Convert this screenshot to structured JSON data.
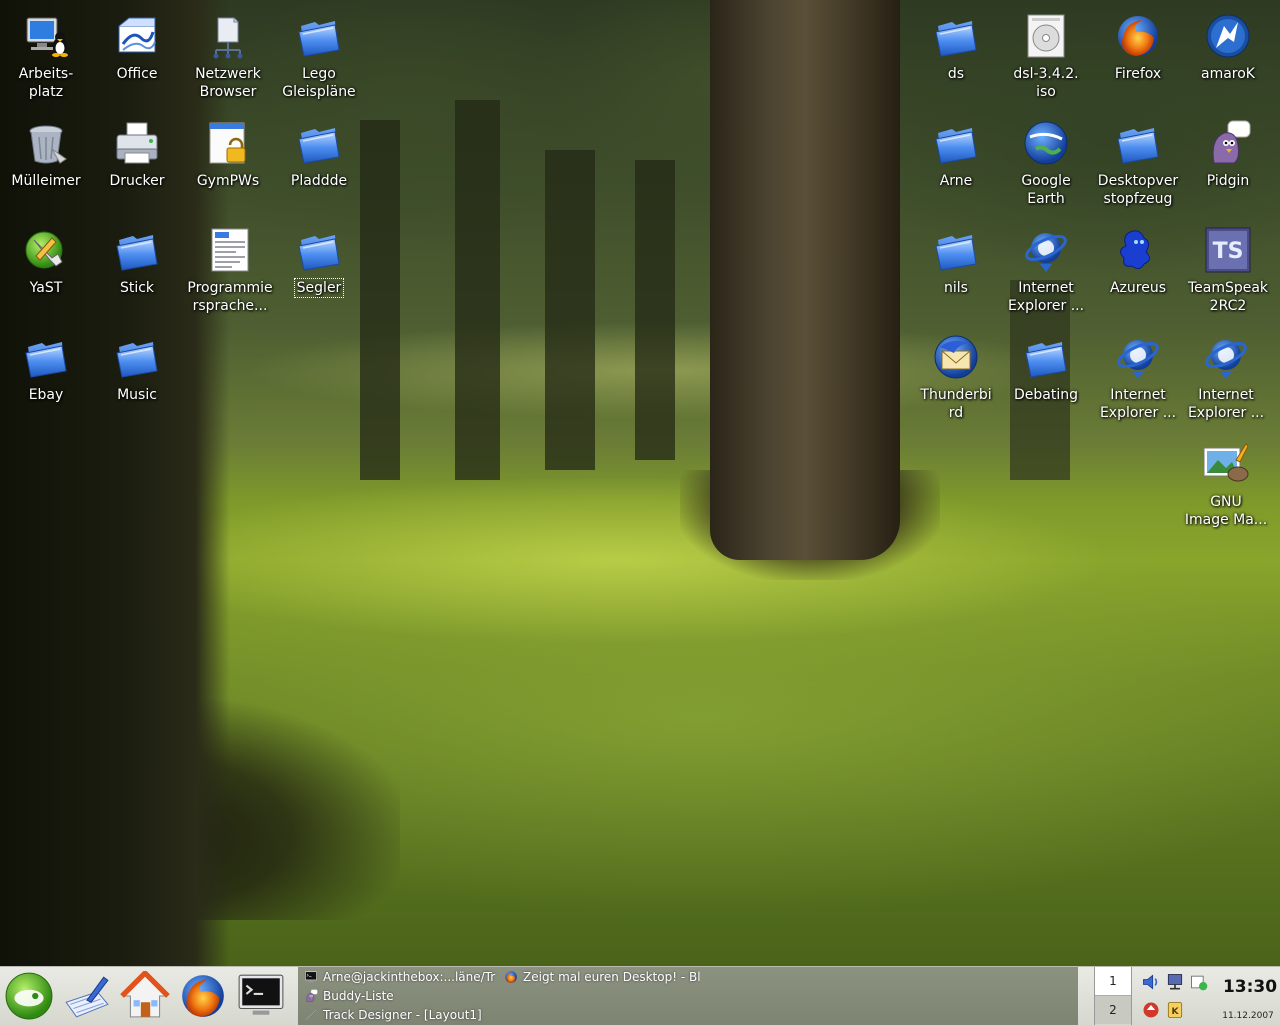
{
  "desktop": {
    "icons_left": [
      {
        "label": "Arbeits-\nplatz",
        "icon": "computer-icon"
      },
      {
        "label": "Office",
        "icon": "office-icon"
      },
      {
        "label": "Netzwerk\nBrowser",
        "icon": "network-icon"
      },
      {
        "label": "Lego\nGleispläne",
        "icon": "folder-icon"
      },
      {
        "label": "Mülleimer",
        "icon": "trash-icon"
      },
      {
        "label": "Drucker",
        "icon": "printer-icon"
      },
      {
        "label": "GymPWs",
        "icon": "locked-file-icon"
      },
      {
        "label": "Pladdde",
        "icon": "folder-icon"
      },
      {
        "label": "YaST",
        "icon": "yast-icon"
      },
      {
        "label": "Stick",
        "icon": "folder-icon"
      },
      {
        "label": "Programmie\nrsprache...",
        "icon": "document-icon"
      },
      {
        "label": "Segler",
        "icon": "folder-icon"
      },
      {
        "label": "Ebay",
        "icon": "folder-icon"
      },
      {
        "label": "Music",
        "icon": "folder-icon"
      }
    ],
    "icons_right": [
      {
        "label": "ds",
        "icon": "folder-icon"
      },
      {
        "label": "dsl-3.4.2.\niso",
        "icon": "disc-image-icon"
      },
      {
        "label": "Firefox",
        "icon": "firefox-icon"
      },
      {
        "label": "amaroK",
        "icon": "amarok-icon"
      },
      {
        "label": "Arne",
        "icon": "folder-icon"
      },
      {
        "label": "Google\nEarth",
        "icon": "google-earth-icon"
      },
      {
        "label": "Desktopver\nstopfzeug",
        "icon": "folder-icon"
      },
      {
        "label": "Pidgin",
        "icon": "pidgin-icon"
      },
      {
        "label": "nils",
        "icon": "folder-icon"
      },
      {
        "label": "Internet\nExplorer ...",
        "icon": "internet-explorer-icon"
      },
      {
        "label": "Azureus",
        "icon": "azureus-icon"
      },
      {
        "label": "TeamSpeak\n2RC2",
        "icon": "teamspeak-icon"
      },
      {
        "label": "Thunderbi\nrd",
        "icon": "thunderbird-icon"
      },
      {
        "label": "Debating",
        "icon": "folder-icon"
      },
      {
        "label": "Internet\nExplorer ...",
        "icon": "internet-explorer-icon"
      },
      {
        "label": "Internet\nExplorer ...",
        "icon": "internet-explorer-icon"
      },
      {
        "label": "GNU\nImage Ma...",
        "icon": "gimp-icon"
      }
    ]
  },
  "taskbar": {
    "launchers": [
      "suse-menu-icon",
      "kwrite-icon",
      "home-icon",
      "firefox-icon",
      "terminal-icon"
    ],
    "tasks": [
      {
        "label": "Arne@jackinthebox:...läne/Tr",
        "icon": "terminal-icon"
      },
      {
        "label": "Zeigt mal euren Desktop! - Bl",
        "icon": "firefox-icon"
      },
      {
        "label": "Buddy-Liste",
        "icon": "pidgin-icon"
      },
      {
        "label": "Track Designer - [Layout1]",
        "icon": "track-designer-icon"
      }
    ],
    "pager": {
      "desk1": "1",
      "desk2": "2"
    },
    "tray": [
      "volume-icon",
      "network-monitor-icon",
      "klipper-icon",
      "update-icon",
      "wine-icon",
      "keyboard-icon"
    ],
    "clock": {
      "time": "13:30",
      "date": "11.12.2007"
    }
  },
  "colors": {
    "folder_blue": "#3a7be0",
    "taskbar_bg": "#dcded6",
    "task_area": "#858b79"
  }
}
